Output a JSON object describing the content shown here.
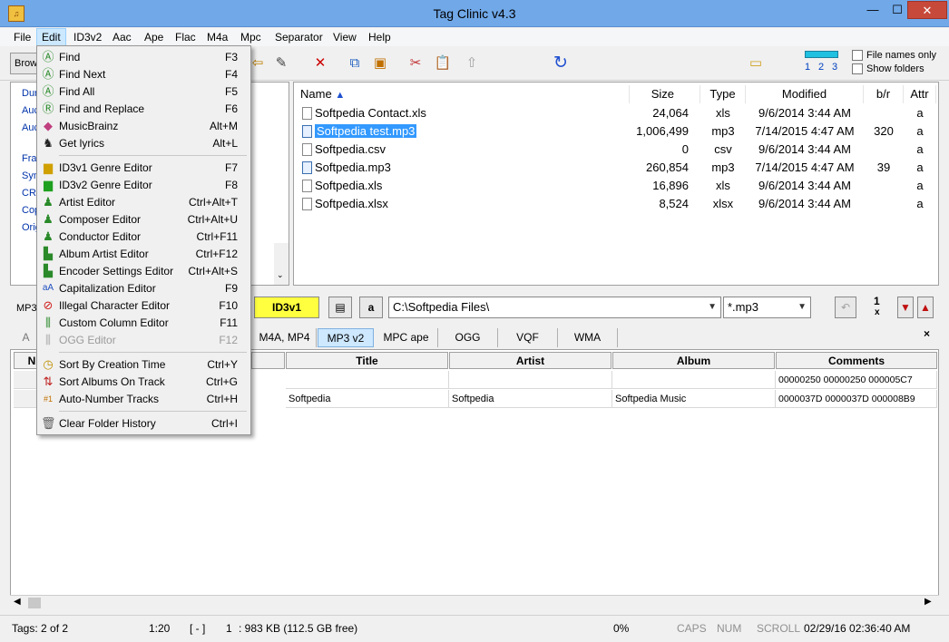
{
  "window": {
    "title": "Tag Clinic v4.3",
    "minimize": "—",
    "maximize": "☐",
    "close": "✕"
  },
  "menubar": [
    "File",
    "Edit",
    "ID3v2",
    "Aac",
    "Ape",
    "Flac",
    "M4a",
    "Mpc",
    "Separator",
    "View",
    "Help"
  ],
  "toolbar": {
    "browse_label": "Brow",
    "level_numbers": [
      "1",
      "2",
      "3"
    ],
    "file_names_only": "File names only",
    "show_folders": "Show folders"
  },
  "tree_items": [
    "Dur",
    "Auc",
    "Auc",
    "Frar",
    "Syn",
    "CRC",
    "Cop",
    "Orig"
  ],
  "file_list": {
    "columns": {
      "name": "Name",
      "size": "Size",
      "type": "Type",
      "modified": "Modified",
      "br": "b/r",
      "attr": "Attr"
    },
    "rows": [
      {
        "name": "Softpedia Contact.xls",
        "size": "24,064",
        "type": "xls",
        "modified": "9/6/2014 3:44 AM",
        "br": "",
        "attr": "a"
      },
      {
        "name": "Softpedia test.mp3",
        "size": "1,006,499",
        "type": "mp3",
        "modified": "7/14/2015 4:47 AM",
        "br": "320",
        "attr": "a"
      },
      {
        "name": "Softpedia.csv",
        "size": "0",
        "type": "csv",
        "modified": "9/6/2014 3:44 AM",
        "br": "",
        "attr": "a"
      },
      {
        "name": "Softpedia.mp3",
        "size": "260,854",
        "type": "mp3",
        "modified": "7/14/2015 4:47 AM",
        "br": "39",
        "attr": "a"
      },
      {
        "name": "Softpedia.xls",
        "size": "16,896",
        "type": "xls",
        "modified": "9/6/2014 3:44 AM",
        "br": "",
        "attr": "a"
      },
      {
        "name": "Softpedia.xlsx",
        "size": "8,524",
        "type": "xlsx",
        "modified": "9/6/2014 3:44 AM",
        "br": "",
        "attr": "a"
      }
    ]
  },
  "midbar": {
    "mp3_label": "MP3",
    "id3v1_label": "ID3v1",
    "a_label": "a",
    "path": "C:\\Softpedia Files\\",
    "ext": "*.mp3",
    "one_label": "1",
    "x_label": "x"
  },
  "tag_tabs": [
    "M4A, MP4",
    "MP3 v2",
    "MPC ape",
    "OGG",
    "VQF",
    "WMA"
  ],
  "tag_tab_partial": "A",
  "grid": {
    "headers": {
      "no": "N",
      "title": "Title",
      "artist": "Artist",
      "album": "Album",
      "comments": "Comments"
    },
    "rows": [
      {
        "no": "1",
        "title": "",
        "artist": "",
        "album": "",
        "comments": "00000250 00000250 000005C7"
      },
      {
        "no": "2",
        "title": "Softpedia",
        "artist": "Softpedia",
        "album": "Softpedia Music",
        "comments": "0000037D 0000037D 000008B9"
      }
    ]
  },
  "statusbar": {
    "tags": "Tags: 2 of 2",
    "time": "1:20",
    "bracket": "[ - ]",
    "one": "1",
    "size": ": 983 KB  (112.5 GB free)",
    "percent": "0%",
    "caps": "CAPS",
    "num": "NUM",
    "scroll": "SCROLL",
    "datetime": "02/29/16 02:36:40 AM"
  },
  "edit_menu": {
    "groups": [
      [
        {
          "label": "Find",
          "key": "F3",
          "icon": "find-icon"
        },
        {
          "label": "Find Next",
          "key": "F4",
          "icon": "find-next-icon"
        },
        {
          "label": "Find All",
          "key": "F5",
          "icon": "find-all-icon"
        },
        {
          "label": "Find and Replace",
          "key": "F6",
          "icon": "replace-icon"
        },
        {
          "label": "MusicBrainz",
          "key": "Alt+M",
          "icon": "musicbrainz-icon"
        },
        {
          "label": "Get lyrics",
          "key": "Alt+L",
          "icon": "lyrics-icon"
        }
      ],
      [
        {
          "label": "ID3v1 Genre Editor",
          "key": "F7",
          "icon": "genre-icon"
        },
        {
          "label": "ID3v2 Genre Editor",
          "key": "F8",
          "icon": "genre-icon"
        },
        {
          "label": "Artist Editor",
          "key": "Ctrl+Alt+T",
          "icon": "artist-icon"
        },
        {
          "label": "Composer Editor",
          "key": "Ctrl+Alt+U",
          "icon": "composer-icon"
        },
        {
          "label": "Conductor Editor",
          "key": "Ctrl+F11",
          "icon": "conductor-icon"
        },
        {
          "label": "Album Artist Editor",
          "key": "Ctrl+F12",
          "icon": "album-artist-icon"
        },
        {
          "label": "Encoder Settings Editor",
          "key": "Ctrl+Alt+S",
          "icon": "encoder-icon"
        },
        {
          "label": "Capitalization Editor",
          "key": "F9",
          "icon": "capitalization-icon"
        },
        {
          "label": "Illegal Character Editor",
          "key": "F10",
          "icon": "illegal-char-icon"
        },
        {
          "label": "Custom Column Editor",
          "key": "F11",
          "icon": "custom-column-icon"
        },
        {
          "label": "OGG Editor",
          "key": "F12",
          "icon": "ogg-icon",
          "disabled": true
        }
      ],
      [
        {
          "label": "Sort By Creation Time",
          "key": "Ctrl+Y",
          "icon": "clock-icon"
        },
        {
          "label": "Sort Albums On Track",
          "key": "Ctrl+G",
          "icon": "sort-icon"
        },
        {
          "label": "Auto-Number Tracks",
          "key": "Ctrl+H",
          "icon": "number-icon"
        }
      ],
      [
        {
          "label": "Clear Folder History",
          "key": "Ctrl+I",
          "icon": "trash-icon"
        }
      ]
    ]
  }
}
